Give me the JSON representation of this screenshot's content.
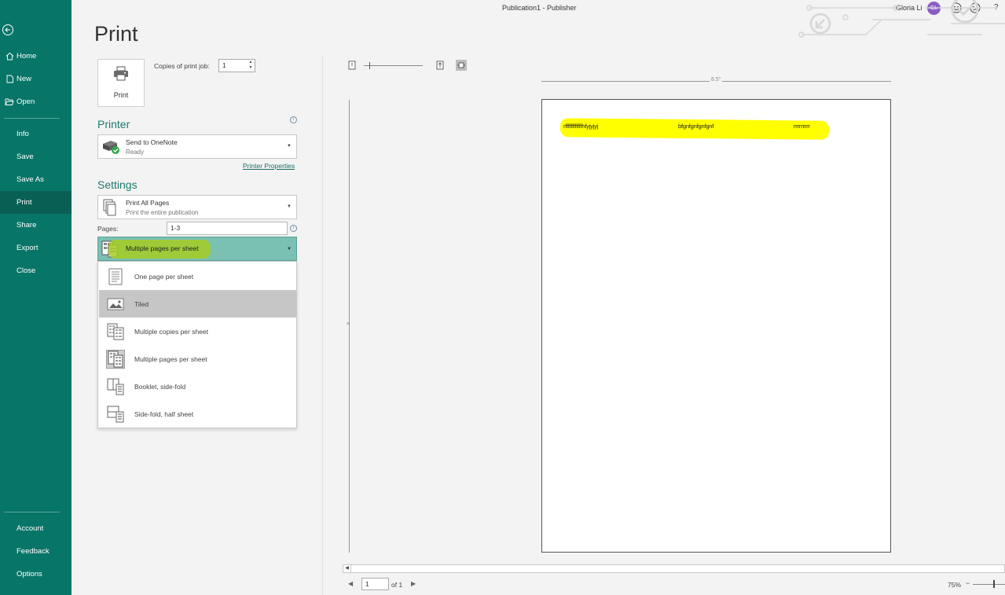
{
  "window": {
    "title": "Publication1  -  Publisher",
    "user_name": "Gloria Li",
    "user_initials": "GL",
    "help_label": "?"
  },
  "sidebar": {
    "top_items": [
      {
        "label": "Home",
        "icon": "home-icon"
      },
      {
        "label": "New",
        "icon": "new-document-icon"
      },
      {
        "label": "Open",
        "icon": "folder-open-icon"
      }
    ],
    "middle_items": [
      {
        "label": "Info"
      },
      {
        "label": "Save"
      },
      {
        "label": "Save As"
      },
      {
        "label": "Print",
        "active": true
      },
      {
        "label": "Share"
      },
      {
        "label": "Export"
      },
      {
        "label": "Close"
      }
    ],
    "bottom_items": [
      {
        "label": "Account"
      },
      {
        "label": "Feedback"
      },
      {
        "label": "Options"
      }
    ]
  },
  "page_title": "Print",
  "print": {
    "button_label": "Print",
    "copies_label": "Copies of print job:",
    "copies_value": "1"
  },
  "printer": {
    "heading": "Printer",
    "name": "Send to OneNote",
    "status": "Ready",
    "properties_link": "Printer Properties"
  },
  "settings": {
    "heading": "Settings",
    "range_title": "Print All Pages",
    "range_sub": "Print the entire publication",
    "pages_label": "Pages:",
    "pages_value": "1-3",
    "layout_selected": "Multiple pages per sheet",
    "layout_options": [
      {
        "label": "One page per sheet",
        "icon": "one-page-icon"
      },
      {
        "label": "Tiled",
        "icon": "tiled-icon",
        "hover": true
      },
      {
        "label": "Multiple copies per sheet",
        "icon": "multiple-copies-icon"
      },
      {
        "label": "Multiple pages per sheet",
        "icon": "multiple-pages-icon",
        "selected": true
      },
      {
        "label": "Booklet, side-fold",
        "icon": "booklet-icon"
      },
      {
        "label": "Side-fold, half sheet",
        "icon": "side-fold-icon"
      }
    ]
  },
  "preview": {
    "ruler_width_label": "8.5\"",
    "sheet_texts": [
      "rffffffffffffhfyjyjyj",
      "bfgnfgnfgnfgnf",
      "rrrrrrrrr"
    ],
    "page_number": "1",
    "page_of": "of 1",
    "zoom": "75%"
  },
  "colors": {
    "sidebar_bg": "#077568",
    "accent": "#1e7a6e",
    "highlight_yellow": "#ffff00",
    "highlight_green": "#a6cc22"
  }
}
